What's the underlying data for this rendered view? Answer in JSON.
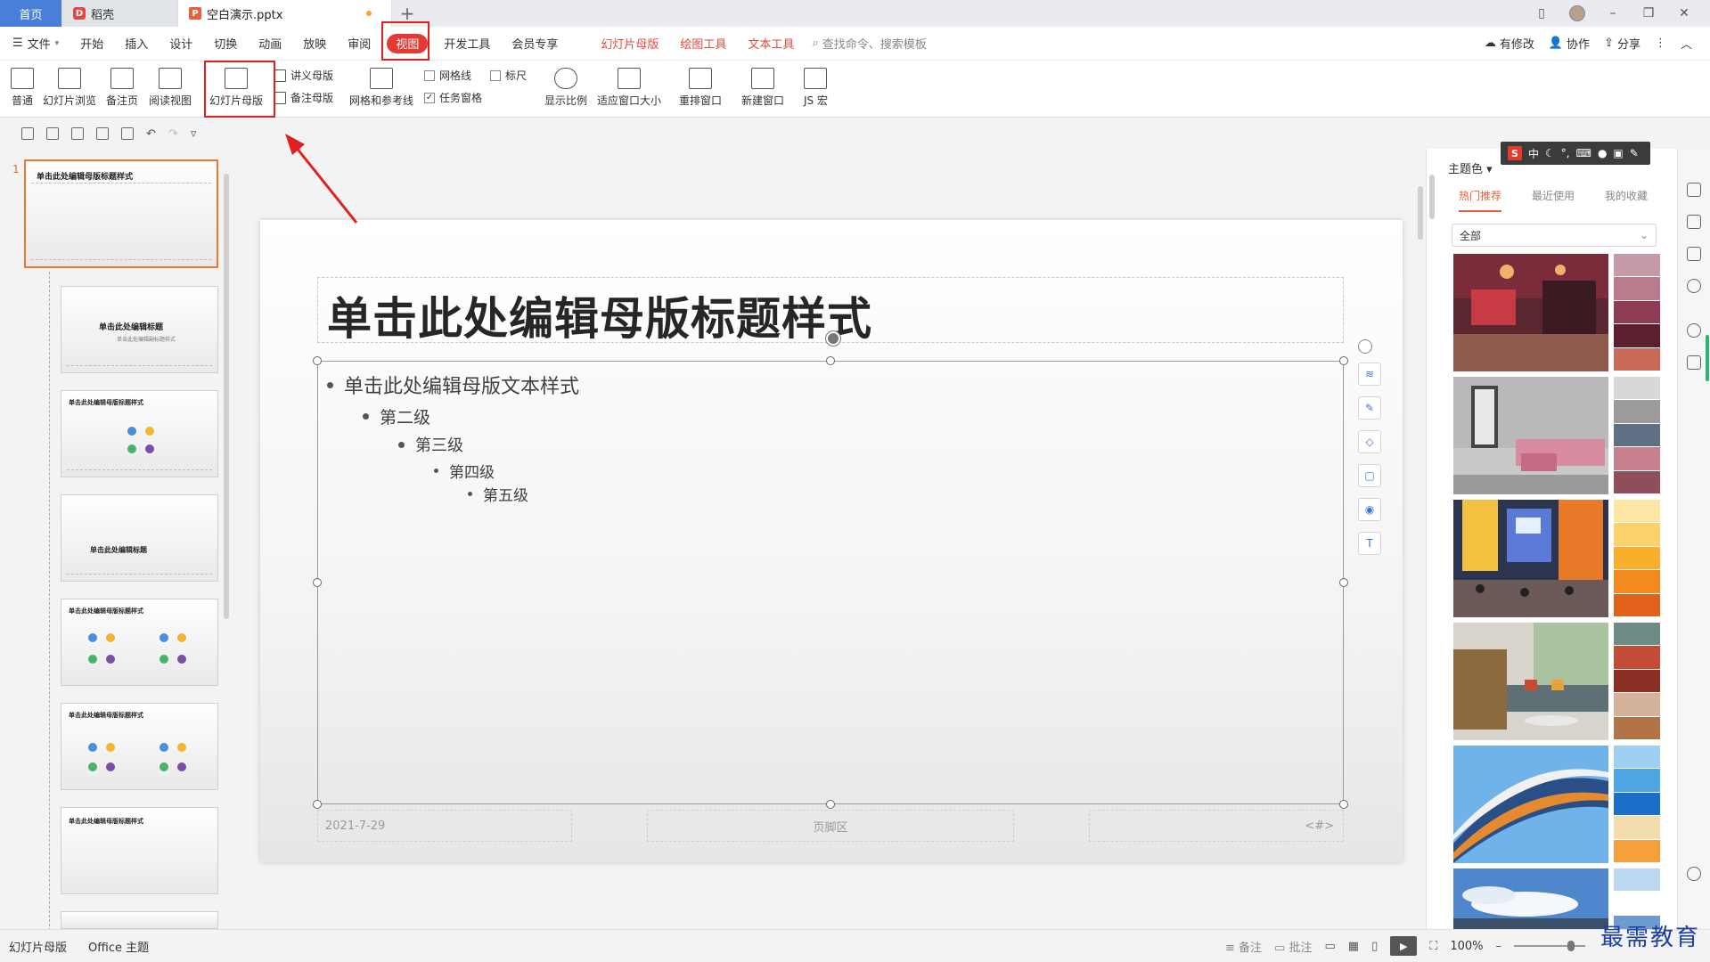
{
  "titlebar": {
    "home_tab": "首页",
    "store_tab": "稻壳",
    "doc_tab": "空白演示.pptx"
  },
  "menu": {
    "file": "文件",
    "items": [
      "开始",
      "插入",
      "设计",
      "切换",
      "动画",
      "放映",
      "审阅"
    ],
    "active": "视图",
    "items2": [
      "开发工具",
      "会员专享"
    ],
    "context_tabs": [
      "幻灯片母版",
      "绘图工具",
      "文本工具"
    ],
    "search_placeholder": "查找命令、搜索模板",
    "right": [
      "有修改",
      "协作",
      "分享"
    ]
  },
  "ribbon": {
    "normal": "普通",
    "slide_sorter": "幻灯片浏览",
    "notes_page": "备注页",
    "reading_view": "阅读视图",
    "slide_master": "幻灯片母版",
    "handout_master": "讲义母版",
    "notes_master": "备注母版",
    "grid_guides": "网格和参考线",
    "gridlines": "网格线",
    "ruler": "标尺",
    "task_pane": "任务窗格",
    "zoom": "显示比例",
    "fit_window": "适应窗口大小",
    "arrange": "重排窗口",
    "new_window": "新建窗口",
    "macro": "JS 宏"
  },
  "thumbnails": {
    "number": "1",
    "master_title": "单击此处编辑母版标题样式",
    "layout_title": "单击此处编辑标题",
    "layout_subtitle": "单击此处编辑副标题样式",
    "layout_section": "单击此处编辑标题",
    "layout_master": "单击此处编辑母版标题样式"
  },
  "slide": {
    "title": "单击此处编辑母版标题样式",
    "level1": "单击此处编辑母版文本样式",
    "level2": "第二级",
    "level3": "第三级",
    "level4": "第四级",
    "level5": "第五级",
    "date": "2021-7-29",
    "footer": "页脚区",
    "page_num": "<#>"
  },
  "right_panel": {
    "header": "主题色",
    "tabs": [
      "热门推荐",
      "最近使用",
      "我的收藏"
    ],
    "filter": "全部",
    "swatches": [
      [
        "#c79aa8",
        "#b97c8d",
        "#8e3c53",
        "#5b1f2e",
        "#c96a58"
      ],
      [
        "#d8d8d8",
        "#9b9b9b",
        "#5f6f84",
        "#c6808e",
        "#8e4f5b"
      ],
      [
        "#fde5a3",
        "#fbd26a",
        "#f9ae2c",
        "#f28a1f",
        "#e2621b"
      ],
      [
        "#6e8b85",
        "#c44b35",
        "#8b2f25",
        "#d3b49a",
        "#b27347"
      ],
      [
        "#9fd0f3",
        "#4fa6e4",
        "#1c6fc6",
        "#f2dcb0",
        "#f5a03a"
      ],
      [
        "#bcd7f0",
        "#ffffff",
        "#6f9ad0",
        "#dfe8f3",
        "#8fb3d9"
      ]
    ]
  },
  "ime": {
    "logo": "S",
    "mode": "中"
  },
  "status": {
    "view": "幻灯片母版",
    "theme": "Office 主题",
    "notes": "备注",
    "comments": "批注",
    "zoom": "100%"
  },
  "watermark": "最需教育"
}
